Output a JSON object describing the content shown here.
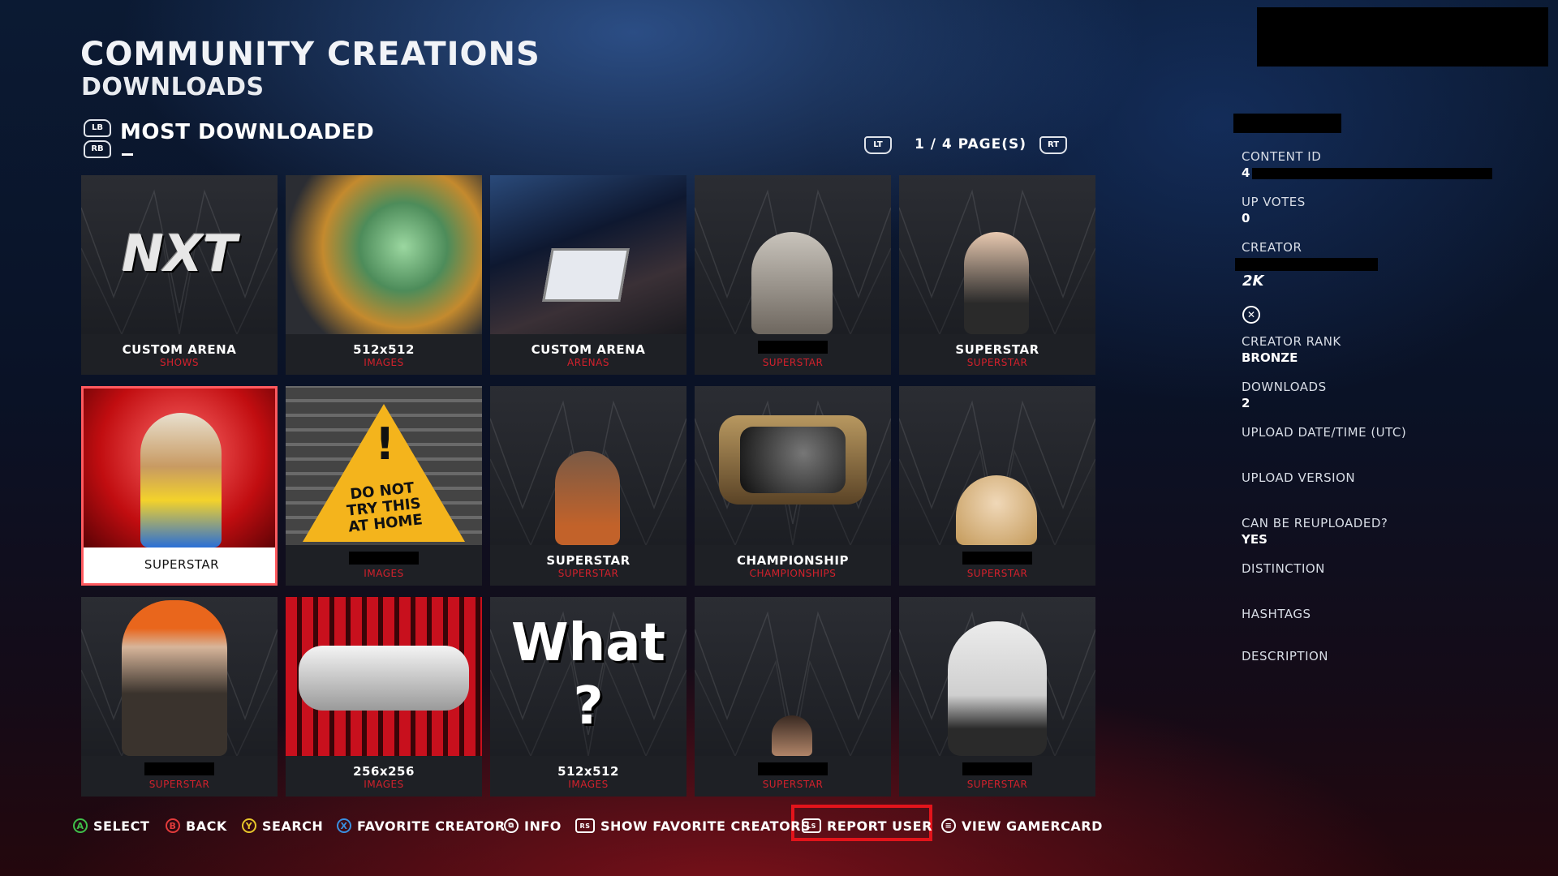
{
  "header": {
    "title": "COMMUNITY CREATIONS",
    "subtitle": "DOWNLOADS"
  },
  "sort": {
    "lb": "LB",
    "rb": "RB",
    "label": "MOST DOWNLOADED"
  },
  "pager": {
    "lt": "LT",
    "rt": "RT",
    "text": "1 / 4 PAGE(S)"
  },
  "tiles": [
    {
      "title": "CUSTOM ARENA",
      "category": "SHOWS",
      "art": "nxt-logo"
    },
    {
      "title": "512x512",
      "category": "IMAGES",
      "art": "dragon"
    },
    {
      "title": "CUSTOM ARENA",
      "category": "ARENAS",
      "art": "arena"
    },
    {
      "title": "",
      "category": "SUPERSTAR",
      "art": "bearded"
    },
    {
      "title": "SUPERSTAR",
      "category": "SUPERSTAR",
      "art": "bald"
    },
    {
      "title": "SUPERSTAR",
      "category": "",
      "art": "hero",
      "selected": true
    },
    {
      "title": "",
      "category": "IMAGES",
      "art": "warning-sign",
      "sign_text": "DO NOT TRY THIS AT HOME"
    },
    {
      "title": "SUPERSTAR",
      "category": "SUPERSTAR",
      "art": "wrestler"
    },
    {
      "title": "CHAMPIONSHIP",
      "category": "CHAMPIONSHIPS",
      "art": "belt"
    },
    {
      "title": "",
      "category": "SUPERSTAR",
      "art": "curly"
    },
    {
      "title": "",
      "category": "SUPERSTAR",
      "art": "chef"
    },
    {
      "title": "256x256",
      "category": "IMAGES",
      "art": "nxt-belt"
    },
    {
      "title": "512x512",
      "category": "IMAGES",
      "art": "what",
      "art_text": "What ?"
    },
    {
      "title": "",
      "category": "SUPERSTAR",
      "art": "shouting"
    },
    {
      "title": "",
      "category": "SUPERSTAR",
      "art": "cat"
    }
  ],
  "details": {
    "content_id_label": "CONTENT ID",
    "content_id_value": "4",
    "up_votes_label": "UP VOTES",
    "up_votes_value": "0",
    "creator_label": "CREATOR",
    "creator_rank_label": "CREATOR RANK",
    "creator_rank_value": "BRONZE",
    "downloads_label": "DOWNLOADS",
    "downloads_value": "2",
    "upload_date_label": "UPLOAD DATE/TIME (UTC)",
    "upload_version_label": "UPLOAD VERSION",
    "reupload_label": "CAN BE REUPLOADED?",
    "reupload_value": "YES",
    "distinction_label": "DISTINCTION",
    "hashtags_label": "HASHTAGS",
    "description_label": "DESCRIPTION"
  },
  "footer": {
    "select": "SELECT",
    "back": "BACK",
    "search": "SEARCH",
    "favorite_creator": "FAVORITE CREATOR",
    "info": "INFO",
    "show_favorite_creators": "SHOW FAVORITE CREATORS",
    "report_user": "REPORT USER",
    "view_gamercard": "VIEW GAMERCARD",
    "glyph_a": "A",
    "glyph_b": "B",
    "glyph_y": "Y",
    "glyph_x": "X",
    "glyph_rs": "RS",
    "glyph_ls": "LS"
  },
  "colors": {
    "accent_red": "#d3212c",
    "report_border": "#e3141b",
    "a": "#3fbf4a",
    "b": "#e23b3b",
    "y": "#e7c52a",
    "x": "#3a8fe0"
  }
}
